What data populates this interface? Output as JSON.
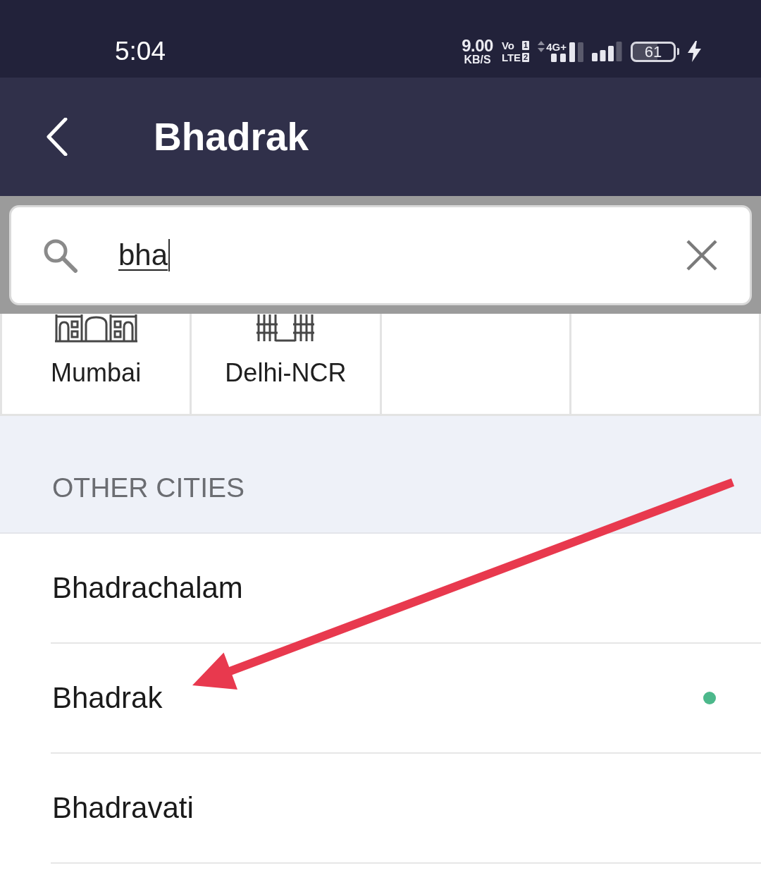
{
  "status_bar": {
    "time": "5:04",
    "network_speed": {
      "value": "9.00",
      "unit": "KB/S"
    },
    "volte": [
      {
        "label": "Vo",
        "sim": "1"
      },
      {
        "label": "LTE",
        "sim": "2"
      }
    ],
    "network_type": "4G+",
    "battery": "61",
    "charging": true
  },
  "app_bar": {
    "title": "Bhadrak"
  },
  "search": {
    "value": "bha"
  },
  "top_cities": [
    {
      "name": "Mumbai",
      "kind": "arches"
    },
    {
      "name": "Delhi-NCR",
      "kind": "gate"
    }
  ],
  "other_cities": {
    "title": "OTHER CITIES",
    "items": [
      {
        "name": "Bhadrachalam",
        "selected": false
      },
      {
        "name": "Bhadrak",
        "selected": true
      },
      {
        "name": "Bhadravati",
        "selected": false
      }
    ]
  },
  "annotations": [
    {
      "kind": "arrow"
    }
  ]
}
